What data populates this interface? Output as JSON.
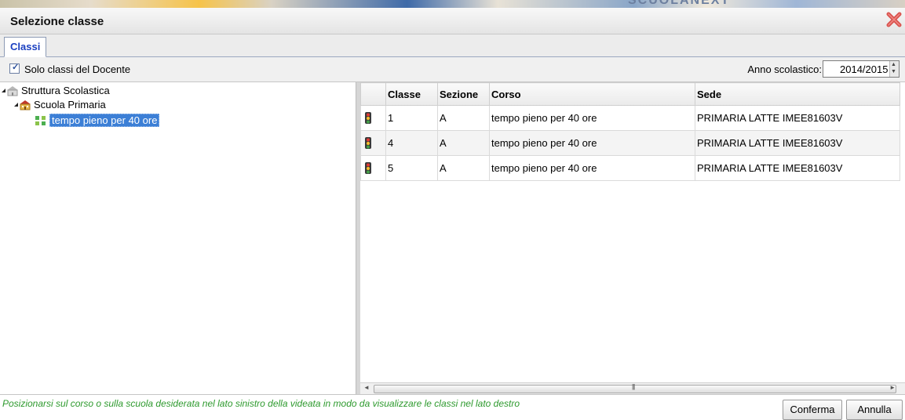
{
  "dialog": {
    "title": "Selezione classe"
  },
  "tabs": [
    {
      "label": "Classi",
      "active": true
    }
  ],
  "filter": {
    "checkbox_label": "Solo classi del Docente",
    "checked": true,
    "anno_label": "Anno scolastico:",
    "anno_value": "2014/2015"
  },
  "tree": {
    "root": {
      "label": "Struttura Scolastica",
      "icon": "school-building-icon"
    },
    "school": {
      "label": "Scuola Primaria",
      "icon": "school-icon"
    },
    "course": {
      "label": "tempo pieno per 40 ore",
      "icon": "course-icon",
      "selected": true
    }
  },
  "grid": {
    "columns": [
      "",
      "Classe",
      "Sezione",
      "Corso",
      "Sede"
    ],
    "rows": [
      {
        "status_icon": "traffic-light-icon",
        "classe": "1",
        "sezione": "A",
        "corso": "tempo pieno per 40 ore",
        "sede": "PRIMARIA LATTE IMEE81603V"
      },
      {
        "status_icon": "traffic-light-icon",
        "classe": "4",
        "sezione": "A",
        "corso": "tempo pieno per 40 ore",
        "sede": "PRIMARIA LATTE IMEE81603V"
      },
      {
        "status_icon": "traffic-light-icon",
        "classe": "5",
        "sezione": "A",
        "corso": "tempo pieno per 40 ore",
        "sede": "PRIMARIA LATTE IMEE81603V"
      }
    ]
  },
  "status": {
    "message": "Posizionarsi sul corso o sulla scuola desiderata nel lato sinistro della videata in modo da visualizzare le classi nel lato destro"
  },
  "buttons": {
    "confirm": "Conferma",
    "cancel": "Annulla"
  },
  "colors": {
    "accent": "#1a3fc0",
    "selection": "#3c7fd6",
    "status_text": "#2e9a2e",
    "close": "#d9534f"
  }
}
